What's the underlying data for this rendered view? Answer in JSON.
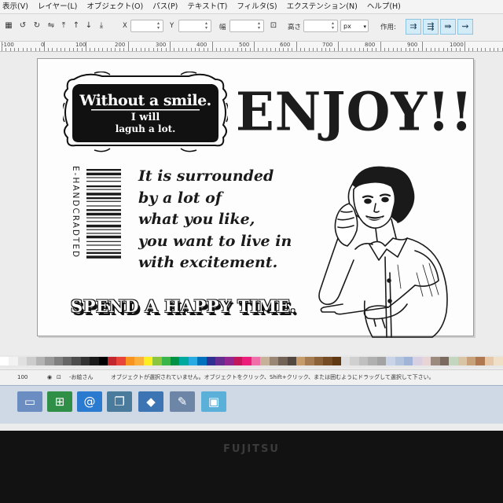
{
  "menu": [
    "表示(V)",
    "レイヤー(L)",
    "オブジェクト(O)",
    "パス(P)",
    "テキスト(T)",
    "フィルタ(S)",
    "エクステンション(N)",
    "ヘルプ(H)"
  ],
  "toolbar": {
    "x_label": "X",
    "y_label": "Y",
    "w_label": "幅",
    "h_label": "高さ",
    "unit": "px",
    "apply_label": "作用:"
  },
  "ruler": [
    "-100",
    "0",
    "100",
    "200",
    "300",
    "400",
    "500",
    "600",
    "700",
    "800",
    "900",
    "1000"
  ],
  "design": {
    "badge_line1": "Without a smile.",
    "badge_line2": "I will",
    "badge_line3": "laguh a lot.",
    "headline": "ENJOY!!",
    "vertical_text": "E-HANDCRADTED",
    "quote_lines": [
      "It is surrounded",
      "by a lot of",
      "what you like,",
      "you want to live in",
      "with excitement."
    ],
    "footer": "SPEND A HAPPY TIME."
  },
  "palette_colors": [
    "#ffffff",
    "#f2f2f2",
    "#e0e0e0",
    "#cccccc",
    "#b3b3b3",
    "#999999",
    "#808080",
    "#666666",
    "#4d4d4d",
    "#333333",
    "#1a1a1a",
    "#000000",
    "#c1272d",
    "#e8443a",
    "#f7931e",
    "#fbb03b",
    "#fcee21",
    "#8cc63f",
    "#39b54a",
    "#009245",
    "#00a99d",
    "#29abe2",
    "#0071bc",
    "#2e3192",
    "#662d91",
    "#93278f",
    "#c2185b",
    "#ed1e79",
    "#f06eaa",
    "#c7b299",
    "#998675",
    "#736357",
    "#534741",
    "#c69c6d",
    "#a67c52",
    "#8c6239",
    "#754c24",
    "#603813",
    "#e0e0e0",
    "#d0d0d0",
    "#c0c0c0",
    "#b0b0b0",
    "#a3a3a3",
    "#c9d4e8",
    "#b3c4df",
    "#9fb4d6",
    "#d8cfe2",
    "#e8d4d4",
    "#9b8a7e",
    "#7a6a60",
    "#c2d6c0",
    "#d9c4a6",
    "#c8a07a",
    "#b07850",
    "#e6c8a8",
    "#f0e0c8"
  ],
  "status": {
    "zoom": "100",
    "layer": "-お絵さん",
    "message": "オブジェクトが選択されていません。オブジェクトをクリック、Shift+クリック、または囲むようにドラッグして選択して下さい。"
  },
  "brand": "FUJITSU"
}
